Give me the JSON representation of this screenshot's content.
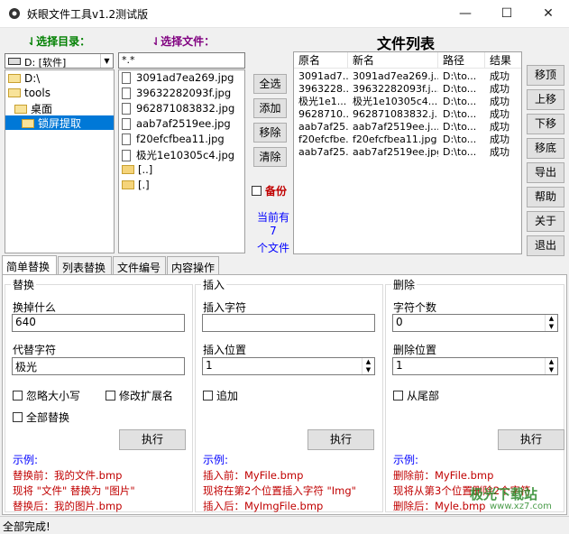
{
  "window": {
    "title": "妖眼文件工具v1.2测试版",
    "minimize": "—",
    "maximize": "☐",
    "close": "✕"
  },
  "labels": {
    "choose_dir": "选择目录：",
    "choose_file": "选择文件：",
    "file_list_title": "文件列表"
  },
  "drive": {
    "value": "D: [软件]"
  },
  "tree": [
    {
      "label": "D:\\"
    },
    {
      "label": "tools"
    },
    {
      "label": "桌面"
    },
    {
      "label": "锁屏提取"
    }
  ],
  "filter": {
    "value": "*.*"
  },
  "files": [
    "3091ad7ea269.jpg",
    "39632282093f.jpg",
    "962871083832.jpg",
    "aab7af2519ee.jpg",
    "f20efcfbea11.jpg",
    "极光1e10305c4.jpg",
    "[..]",
    "[.]"
  ],
  "mid_buttons": {
    "select_all": "全选",
    "add": "添加",
    "remove": "移除",
    "clear": "清除"
  },
  "backup": {
    "label": "备份"
  },
  "count_info": {
    "line1": "当前有",
    "line2": "7",
    "line3": "个文件"
  },
  "list": {
    "headers": [
      "原名",
      "新名",
      "路径",
      "结果"
    ],
    "rows": [
      [
        "3091ad7...",
        "3091ad7ea269.j...",
        "D:\\to...",
        "成功"
      ],
      [
        "3963228...",
        "39632282093f.j...",
        "D:\\to...",
        "成功"
      ],
      [
        "极光1e1...",
        "极光1e10305c4....",
        "D:\\to...",
        "成功"
      ],
      [
        "9628710...",
        "962871083832.j...",
        "D:\\to...",
        "成功"
      ],
      [
        "aab7af25...",
        "aab7af2519ee.j...",
        "D:\\to...",
        "成功"
      ],
      [
        "f20efcfbe...",
        "f20efcfbea11.jpg",
        "D:\\to...",
        "成功"
      ],
      [
        "aab7af25...",
        "aab7af2519ee.jpg",
        "D:\\to...",
        "成功"
      ]
    ]
  },
  "right_buttons": {
    "top": "移顶",
    "up": "上移",
    "down": "下移",
    "bottom": "移底",
    "export": "导出",
    "help": "帮助",
    "about": "关于",
    "exit": "退出"
  },
  "tabs": [
    "简单替换",
    "列表替换",
    "文件编号",
    "内容操作"
  ],
  "replace": {
    "title": "替换",
    "find_label": "换掉什么",
    "find_value": "640",
    "repl_label": "代替字符",
    "repl_value": "极光",
    "ignore_case": "忽略大小写",
    "modify_ext": "修改扩展名",
    "replace_all": "全部替换",
    "exec": "执行",
    "example": "示例:",
    "ex1": "替换前：我的文件.bmp",
    "ex2": "现将 \"文件\" 替换为 \"图片\"",
    "ex3": "替换后：我的图片.bmp"
  },
  "insert": {
    "title": "插入",
    "char_label": "插入字符",
    "char_value": "",
    "pos_label": "插入位置",
    "pos_value": "1",
    "append": "追加",
    "exec": "执行",
    "example": "示例:",
    "ex1": "插入前：MyFile.bmp",
    "ex2": "现将在第2个位置插入字符 \"Img\"",
    "ex3": "插入后：MyImgFile.bmp"
  },
  "delete": {
    "title": "删除",
    "count_label": "字符个数",
    "count_value": "0",
    "pos_label": "删除位置",
    "pos_value": "1",
    "from_end": "从尾部",
    "exec": "执行",
    "example": "示例:",
    "ex1": "删除前：MyFile.bmp",
    "ex2": "现将从第3个位置删除2个字符",
    "ex3": "删除后：Myle.bmp"
  },
  "status": {
    "text": "全部完成!"
  },
  "watermark": {
    "text": "极光下载站",
    "url": "www.xz7.com"
  }
}
